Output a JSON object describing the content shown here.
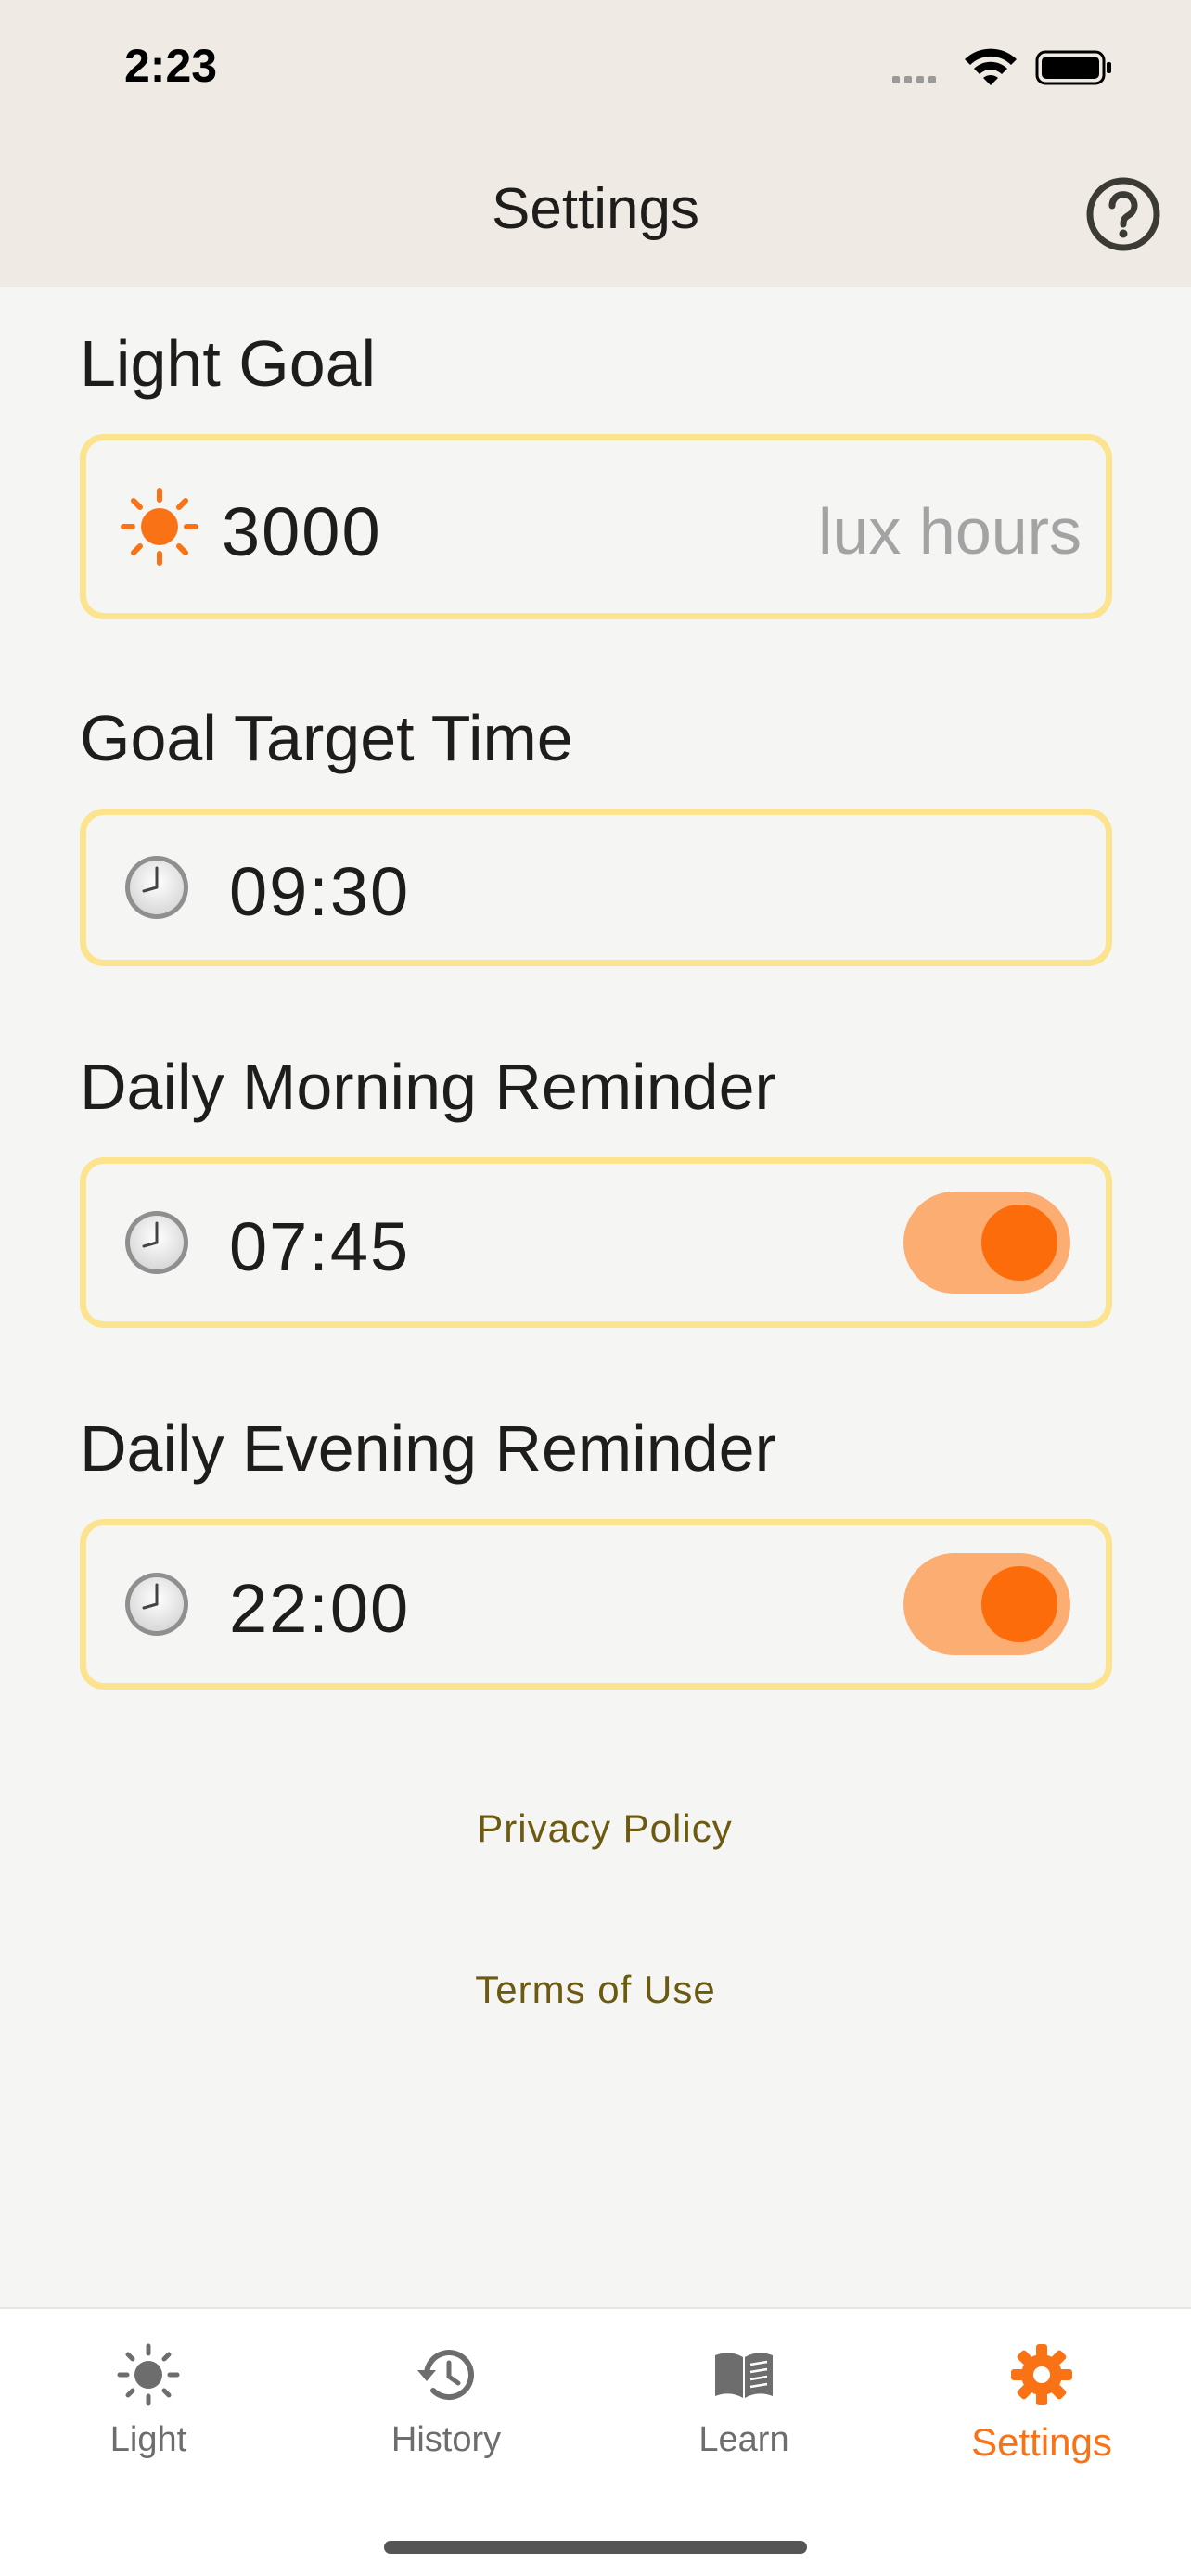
{
  "status_bar": {
    "time": "2:23"
  },
  "nav": {
    "title": "Settings",
    "help_icon": "question-circle-icon"
  },
  "light_goal": {
    "label": "Light Goal",
    "value": "3000",
    "unit": "lux hours",
    "icon": "sun-icon"
  },
  "goal_target_time": {
    "label": "Goal Target Time",
    "value": "09:30",
    "icon": "clock-icon"
  },
  "morning_reminder": {
    "label": "Daily Morning Reminder",
    "value": "07:45",
    "enabled": true,
    "icon": "clock-icon"
  },
  "evening_reminder": {
    "label": "Daily Evening Reminder",
    "value": "22:00",
    "enabled": true,
    "icon": "clock-icon"
  },
  "links": {
    "privacy": "Privacy Policy",
    "terms": "Terms of Use"
  },
  "tabs": [
    {
      "label": "Light",
      "icon": "sun-icon",
      "active": false
    },
    {
      "label": "History",
      "icon": "history-icon",
      "active": false
    },
    {
      "label": "Learn",
      "icon": "book-icon",
      "active": false
    },
    {
      "label": "Settings",
      "icon": "gear-icon",
      "active": true
    }
  ],
  "colors": {
    "accent": "#f97316",
    "field_border": "#fce38d",
    "toggle_track": "#fbad72",
    "toggle_knob": "#fd6c0a",
    "link": "#6c5a10",
    "header_bg": "#efebe4",
    "page_bg": "#f5f5f4"
  }
}
